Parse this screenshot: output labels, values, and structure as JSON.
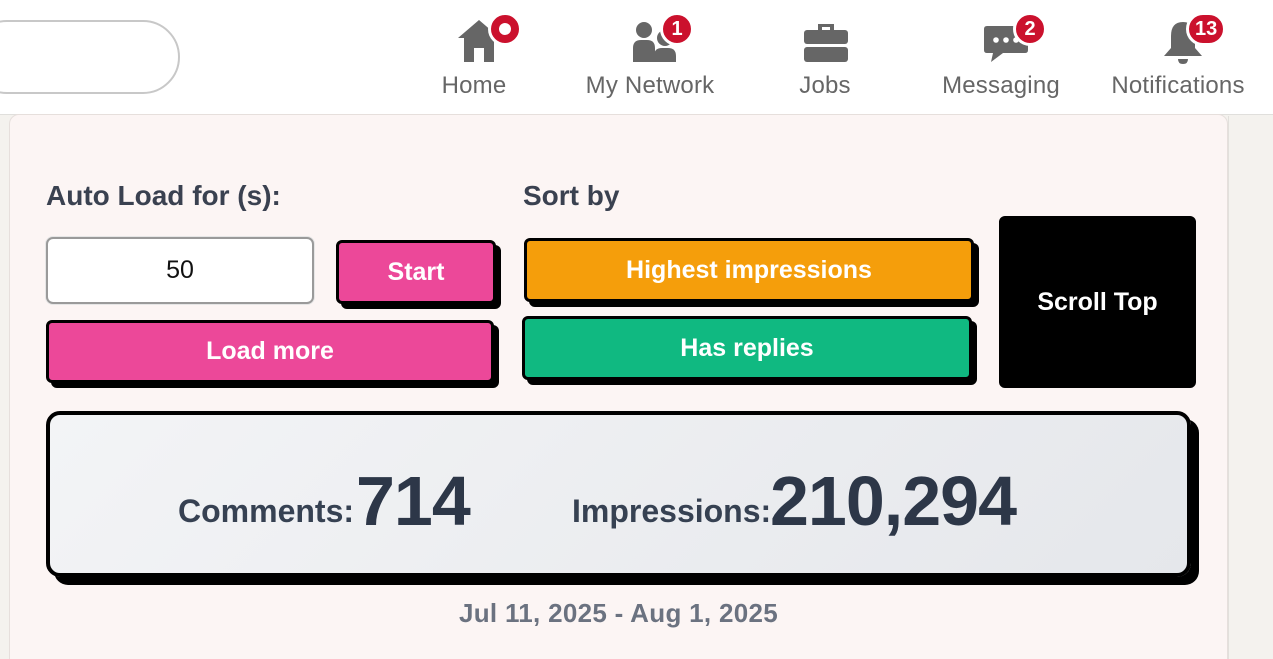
{
  "nav": {
    "items": [
      {
        "label": "Home",
        "icon": "home-icon",
        "badge": ""
      },
      {
        "label": "My Network",
        "icon": "network-icon",
        "badge": "1"
      },
      {
        "label": "Jobs",
        "icon": "briefcase-icon",
        "badge": ""
      },
      {
        "label": "Messaging",
        "icon": "message-icon",
        "badge": "2"
      },
      {
        "label": "Notifications",
        "icon": "bell-icon",
        "badge": "13"
      }
    ]
  },
  "controls": {
    "auto_load_label": "Auto Load for (s):",
    "auto_load_value": "50",
    "start_label": "Start",
    "load_more_label": "Load more",
    "sort_label": "Sort by",
    "highest_impressions_label": "Highest impressions",
    "has_replies_label": "Has replies",
    "scroll_top_label": "Scroll Top"
  },
  "stats": {
    "comments_label": "Comments:",
    "comments_value": "714",
    "impressions_label": "Impressions:",
    "impressions_value": "210,294"
  },
  "date_range": "Jul 11, 2025 - Aug 1, 2025",
  "colors": {
    "pink": "#ec4899",
    "orange": "#f59e0b",
    "green": "#10b981",
    "badge_red": "#cb112d"
  }
}
